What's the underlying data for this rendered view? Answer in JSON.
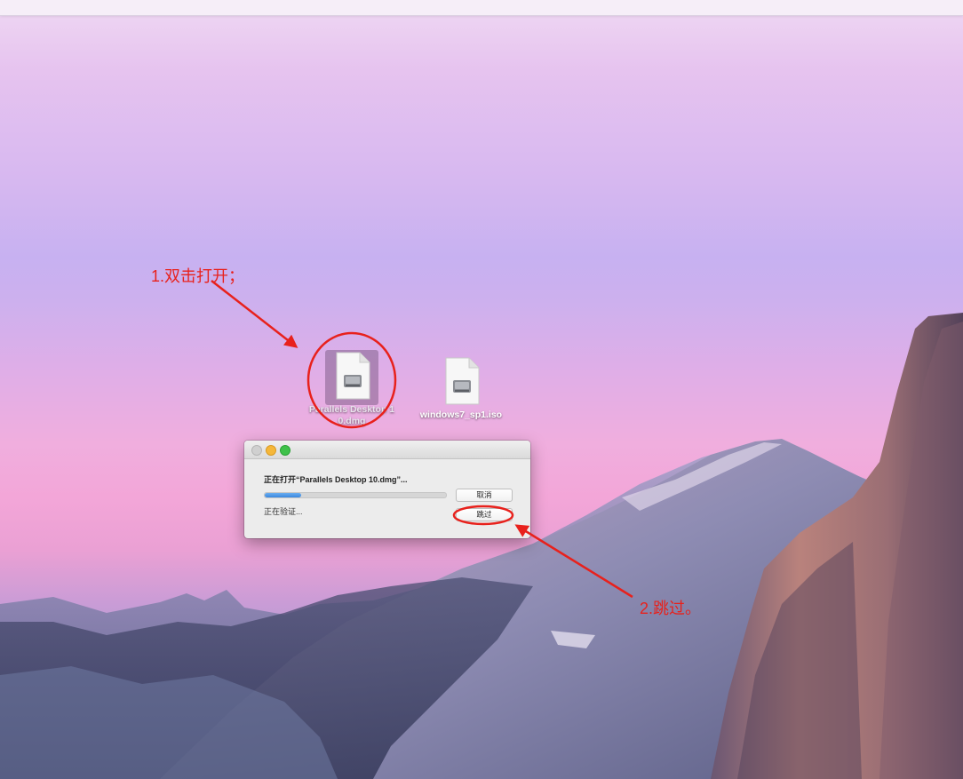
{
  "desktop": {
    "icons": [
      {
        "label": "Parallels Desktop 10.dmg",
        "icon": "disk-image-icon"
      },
      {
        "label": "windows7_sp1.iso",
        "icon": "disk-image-icon"
      }
    ]
  },
  "dialog": {
    "message": "正在打开“Parallels Desktop 10.dmg”...",
    "status": "正在验证...",
    "progress": 0.2,
    "cancel_label": "取消",
    "skip_label": "跳过"
  },
  "annotations": {
    "step1": "1.双击打开；",
    "step2": "2.跳过。",
    "color": "#e8211c"
  }
}
